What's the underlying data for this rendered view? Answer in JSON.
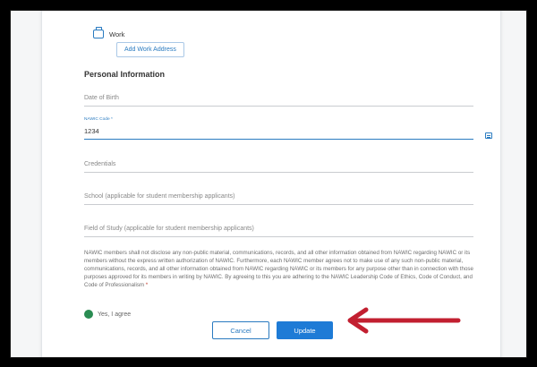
{
  "work": {
    "label": "Work",
    "add_button": "Add Work Address"
  },
  "personal_info": {
    "title": "Personal Information",
    "date_of_birth": {
      "placeholder": "Date of Birth"
    },
    "nawic_code": {
      "label": "NAWIC Code *",
      "value": "1234"
    },
    "credentials": {
      "placeholder": "Credentials"
    },
    "school": {
      "placeholder": "School (applicable for student membership applicants)"
    },
    "field_of_study": {
      "placeholder": "Field of Study (applicable for student membership applicants)"
    }
  },
  "policy": {
    "text": "NAWIC members shall not disclose any non-public material, communications, records, and all other information obtained from NAWIC regarding NAWIC or its members without the express written authorization of NAWIC. Furthermore, each NAWIC member agrees not to make use of any such non-public material, communications, records, and all other information obtained from NAWIC regarding NAWIC or its members for any purpose other than in connection with those purposes approved for its members in writing by NAWIC. By agreeing to this you are adhering to the NAWIC Leadership Code of Ethics, Code of Conduct, and Code of Professionalism",
    "required_mark": "*"
  },
  "agree": {
    "label": "Yes, I agree"
  },
  "actions": {
    "cancel": "Cancel",
    "update": "Update"
  },
  "colors": {
    "accent": "#1e7bd6",
    "radio_selected": "#2a8c52",
    "annotation_arrow": "#c21f30"
  }
}
